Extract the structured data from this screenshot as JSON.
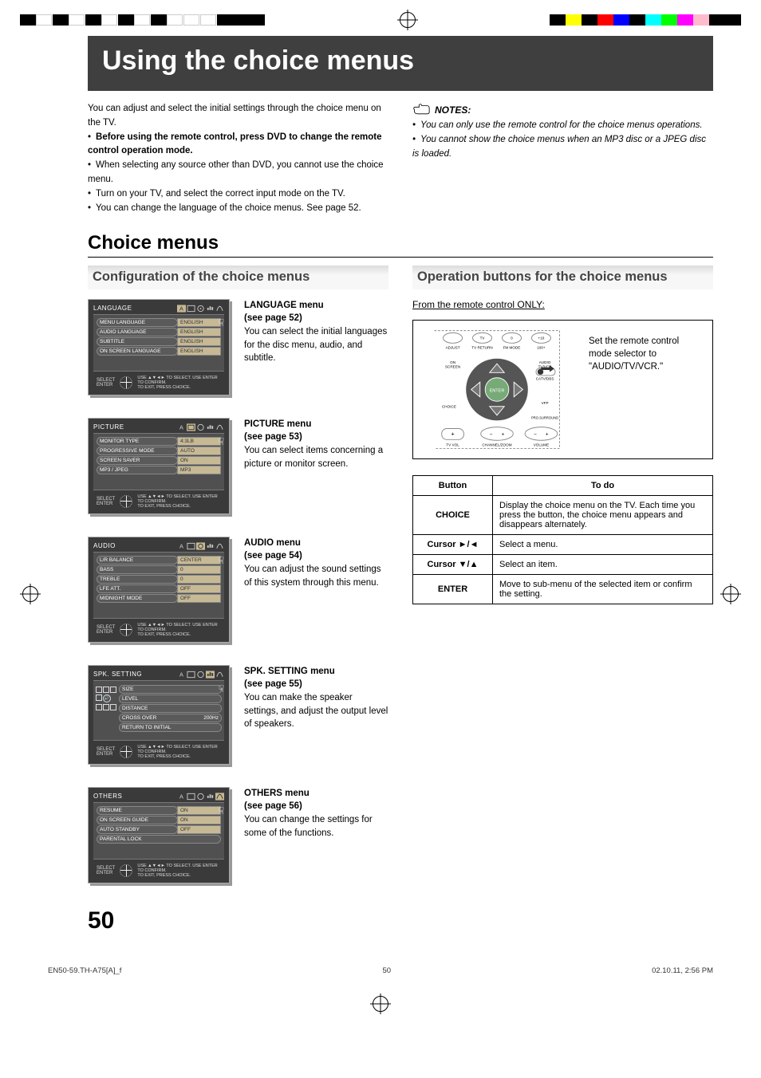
{
  "hero": "Using the choice menus",
  "intro_paragraph": "You can adjust and select the initial settings through the choice menu on the TV.",
  "intro_bullets": [
    "Before using the remote control, press DVD to change the remote control operation mode.",
    "When selecting any source other than DVD, you cannot use the choice menu.",
    "Turn on your TV, and select the correct input mode on the TV.",
    "You can change the language of the choice menus. See page 52."
  ],
  "notes_label": "NOTES:",
  "notes": [
    "You can only use the remote control for the choice menus operations.",
    "You cannot show the choice menus when an MP3 disc or a JPEG disc is loaded."
  ],
  "section_title": "Choice menus",
  "subsection_left": "Configuration of the choice menus",
  "subsection_right": "Operation buttons for the choice menus",
  "menu_blocks": [
    {
      "shot_title": "LANGUAGE",
      "rows": [
        {
          "k": "MENU LANGUAGE",
          "v": "ENGLISH"
        },
        {
          "k": "AUDIO LANGUAGE",
          "v": "ENGLISH"
        },
        {
          "k": "SUBTITLE",
          "v": "ENGLISH"
        },
        {
          "k": "ON SCREEN LANGUAGE",
          "v": "ENGLISH"
        }
      ],
      "foot_select": "SELECT",
      "foot_enter": "ENTER",
      "foot_hint": "USE ▲▼◄► TO SELECT.  USE ENTER TO CONFIRM.\nTO EXIT, PRESS CHOICE.",
      "desc_title": "LANGUAGE menu",
      "desc_sub": "(see page 52)",
      "desc_body": "You can select the initial languages for the disc menu, audio, and subtitle."
    },
    {
      "shot_title": "PICTURE",
      "rows": [
        {
          "k": "MONITOR TYPE",
          "v": "4:3LB"
        },
        {
          "k": "PROGRESSIVE MODE",
          "v": "AUTO"
        },
        {
          "k": "SCREEN SAVER",
          "v": "ON"
        },
        {
          "k": "MP3 / JPEG",
          "v": "MP3"
        }
      ],
      "foot_select": "SELECT",
      "foot_enter": "ENTER",
      "foot_hint": "USE ▲▼◄► TO SELECT.  USE ENTER TO CONFIRM.\nTO EXIT, PRESS CHOICE.",
      "desc_title": "PICTURE menu",
      "desc_sub": "(see page 53)",
      "desc_body": "You can select items concerning a picture or monitor screen."
    },
    {
      "shot_title": "AUDIO",
      "rows": [
        {
          "k": "L/R BALANCE",
          "v": "CENTER"
        },
        {
          "k": "BASS",
          "v": "0"
        },
        {
          "k": "TREBLE",
          "v": "0"
        },
        {
          "k": "LFE ATT.",
          "v": "OFF"
        },
        {
          "k": "MIDNIGHT MODE",
          "v": "OFF"
        }
      ],
      "foot_select": "SELECT",
      "foot_enter": "ENTER",
      "foot_hint": "USE ▲▼◄► TO SELECT.  USE ENTER TO CONFIRM.\nTO EXIT, PRESS CHOICE.",
      "desc_title": "AUDIO menu",
      "desc_sub": "(see page 54)",
      "desc_body": "You can adjust the sound settings of this system through this menu."
    },
    {
      "shot_title": "SPK. SETTING",
      "spk_rows": [
        {
          "k": "SIZE",
          "v": ""
        },
        {
          "k": "LEVEL",
          "v": ""
        },
        {
          "k": "DISTANCE",
          "v": ""
        },
        {
          "k": "CROSS OVER",
          "v": "200Hz"
        },
        {
          "k": "RETURN TO INITIAL",
          "v": ""
        }
      ],
      "foot_select": "SELECT",
      "foot_enter": "ENTER",
      "foot_hint": "USE ▲▼◄► TO SELECT.  USE ENTER TO CONFIRM.\nTO EXIT, PRESS CHOICE.",
      "desc_title": "SPK. SETTING menu",
      "desc_sub": "(see page 55)",
      "desc_body": "You can make the speaker settings, and adjust the output level of speakers."
    },
    {
      "shot_title": "OTHERS",
      "rows": [
        {
          "k": "RESUME",
          "v": "ON"
        },
        {
          "k": "ON SCREEN GUIDE",
          "v": "ON"
        },
        {
          "k": "AUTO STANDBY",
          "v": "OFF"
        },
        {
          "k": "PARENTAL LOCK",
          "v": ""
        }
      ],
      "foot_select": "SELECT",
      "foot_enter": "ENTER",
      "foot_hint": "USE ▲▼◄► TO SELECT.  USE ENTER TO CONFIRM.\nTO EXIT, PRESS CHOICE.",
      "desc_title": "OTHERS menu",
      "desc_sub": "(see page 56)",
      "desc_body": "You can change the settings for some of the functions."
    }
  ],
  "from_remote": "From the remote control ONLY:",
  "remote_hint_line1": "Set the remote control mode selector to \"AUDIO/TV/VCR.\"",
  "remote_labels": {
    "adjust": "ADJUST",
    "tvreturn": "TV RETURN",
    "tv": "TV",
    "fmmode": "FM MODE",
    "zero": "0",
    "plus10": "+10",
    "hundred": "100+",
    "onscreen": "ON SCREEN",
    "audiotvvcr": "AUDIO TV/VCR",
    "catvideo": "CATV/DBS",
    "choice": "CHOICE",
    "enter": "ENTER",
    "vfp": "VFP",
    "prosurr": "PRO.SURROUND",
    "tvvol": "TV VOL",
    "channelzoom": "CHANNEL/ZOOM",
    "volume": "VOLUME"
  },
  "button_table": {
    "head": {
      "button": "Button",
      "todo": "To do"
    },
    "rows": [
      {
        "button": "CHOICE",
        "todo": "Display the choice menu on the TV. Each time you press the button, the choice menu appears and disappears alternately."
      },
      {
        "button": "Cursor ►/◄",
        "todo": "Select a menu."
      },
      {
        "button": "Cursor ▼/▲",
        "todo": "Select an item."
      },
      {
        "button": "ENTER",
        "todo": "Move to sub-menu of the selected item or confirm the setting."
      }
    ]
  },
  "page_number": "50",
  "footer_file": "EN50-59.TH-A75[A]_f",
  "footer_page": "50",
  "footer_date": "02.10.11, 2:56 PM"
}
